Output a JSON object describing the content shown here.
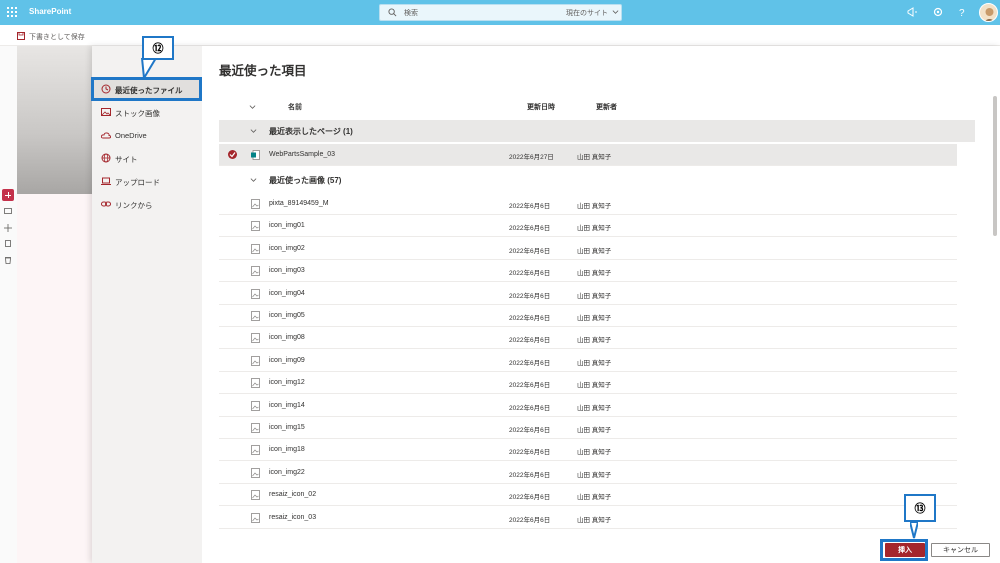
{
  "app": {
    "title": "SharePoint"
  },
  "search": {
    "placeholder": "検索",
    "scope": "現在のサイト"
  },
  "page": {
    "draft_label": "下書きとして保存"
  },
  "nav": {
    "items": [
      {
        "label": "最近使ったファイル",
        "icon": "clock-icon"
      },
      {
        "label": "ストック画像",
        "icon": "image-icon"
      },
      {
        "label": "OneDrive",
        "icon": "cloud-icon"
      },
      {
        "label": "サイト",
        "icon": "globe-icon"
      },
      {
        "label": "アップロード",
        "icon": "laptop-icon"
      },
      {
        "label": "リンクから",
        "icon": "link-icon"
      }
    ]
  },
  "panel": {
    "title": "最近使った項目",
    "columns": {
      "name": "名前",
      "modified": "更新日時",
      "modified_by": "更新者"
    }
  },
  "groups": [
    {
      "label": "最近表示したページ (1)",
      "files": [
        {
          "name": "WebPartsSample_03",
          "date": "2022年6月27日",
          "user": "山田 真知子",
          "type": "page",
          "selected": true
        }
      ]
    },
    {
      "label": "最近使った画像 (57)",
      "files": [
        {
          "name": "pixta_89149459_M",
          "date": "2022年6月6日",
          "user": "山田 真知子"
        },
        {
          "name": "icon_img01",
          "date": "2022年6月6日",
          "user": "山田 真知子"
        },
        {
          "name": "icon_img02",
          "date": "2022年6月6日",
          "user": "山田 真知子"
        },
        {
          "name": "icon_img03",
          "date": "2022年6月6日",
          "user": "山田 真知子"
        },
        {
          "name": "icon_img04",
          "date": "2022年6月6日",
          "user": "山田 真知子"
        },
        {
          "name": "icon_img05",
          "date": "2022年6月6日",
          "user": "山田 真知子"
        },
        {
          "name": "icon_img08",
          "date": "2022年6月6日",
          "user": "山田 真知子"
        },
        {
          "name": "icon_img09",
          "date": "2022年6月6日",
          "user": "山田 真知子"
        },
        {
          "name": "icon_img12",
          "date": "2022年6月6日",
          "user": "山田 真知子"
        },
        {
          "name": "icon_img14",
          "date": "2022年6月6日",
          "user": "山田 真知子"
        },
        {
          "name": "icon_img15",
          "date": "2022年6月6日",
          "user": "山田 真知子"
        },
        {
          "name": "icon_img18",
          "date": "2022年6月6日",
          "user": "山田 真知子"
        },
        {
          "name": "icon_img22",
          "date": "2022年6月6日",
          "user": "山田 真知子"
        },
        {
          "name": "resaiz_icon_02",
          "date": "2022年6月6日",
          "user": "山田 真知子"
        },
        {
          "name": "resaiz_icon_03",
          "date": "2022年6月6日",
          "user": "山田 真知子"
        }
      ]
    }
  ],
  "buttons": {
    "insert": "挿入",
    "cancel": "キャンセル"
  },
  "annotations": {
    "step12": "⑫",
    "step13": "⑬"
  },
  "colors": {
    "suite_bar": "#60c2e8",
    "accent": "#a4262c",
    "callout": "#1f77c7"
  }
}
